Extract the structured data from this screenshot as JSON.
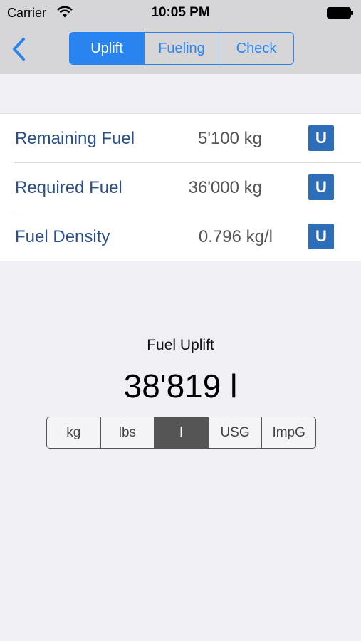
{
  "status_bar": {
    "carrier": "Carrier",
    "time": "10:05 PM"
  },
  "nav": {
    "back_icon": "chevron-left-icon",
    "tabs": [
      {
        "label": "Uplift",
        "active": true
      },
      {
        "label": "Fueling",
        "active": false
      },
      {
        "label": "Check",
        "active": false
      }
    ]
  },
  "fuel_rows": [
    {
      "label": "Remaining Fuel",
      "value": "5'100",
      "unit": "kg",
      "button": "U"
    },
    {
      "label": "Required Fuel",
      "value": "36'000",
      "unit": "kg",
      "button": "U"
    },
    {
      "label": "Fuel Density",
      "value": "0.796",
      "unit": "kg/l",
      "button": "U"
    }
  ],
  "uplift": {
    "title": "Fuel Uplift",
    "value": "38'819 l",
    "units": [
      {
        "label": "kg",
        "selected": false
      },
      {
        "label": "lbs",
        "selected": false
      },
      {
        "label": "l",
        "selected": true
      },
      {
        "label": "USG",
        "selected": false
      },
      {
        "label": "ImpG",
        "selected": false
      }
    ]
  },
  "colors": {
    "accent": "#2a84f0",
    "label_blue": "#2b4f87",
    "u_button": "#2e6db8",
    "unit_selected": "#555555"
  }
}
